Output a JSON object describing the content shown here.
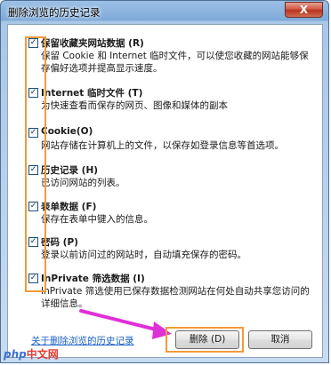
{
  "window": {
    "title": "删除浏览的历史记录",
    "close_label": "X"
  },
  "options": [
    {
      "title": "保留收藏夹网站数据 (R)",
      "desc": "保留 Cookie 和 Internet 临时文件，可以使您收藏的网站能够保存偏好选项并提高显示速度。",
      "checked": true
    },
    {
      "title": "Internet 临时文件 (T)",
      "desc": "为快速查看而保存的网页、图像和媒体的副本",
      "checked": true
    },
    {
      "title": "Cookie(O)",
      "desc": "网站存储在计算机上的文件，以保存如登录信息等首选项。",
      "checked": true
    },
    {
      "title": "历史记录 (H)",
      "desc": "已访问网站的列表。",
      "checked": true
    },
    {
      "title": "表单数据 (F)",
      "desc": "保存在表单中键入的信息。",
      "checked": true
    },
    {
      "title": "密码 (P)",
      "desc": "登录以前访问过的网站时，自动填充保存的密码。",
      "checked": true
    },
    {
      "title": "InPrivate 筛选数据 (I)",
      "desc": "InPrivate 筛选使用已保存数据检测网站在何处自动共享您访问的详细信息。",
      "checked": true
    }
  ],
  "footer": {
    "link": "关于删除浏览的历史记录",
    "delete_label": "删除 (D)",
    "cancel_label": "取消"
  },
  "watermark": {
    "brand": "php",
    "site": "中文网"
  },
  "colors": {
    "highlight": "#f39a3a",
    "arrow": "#e030d8",
    "link": "#1a5fc6"
  }
}
